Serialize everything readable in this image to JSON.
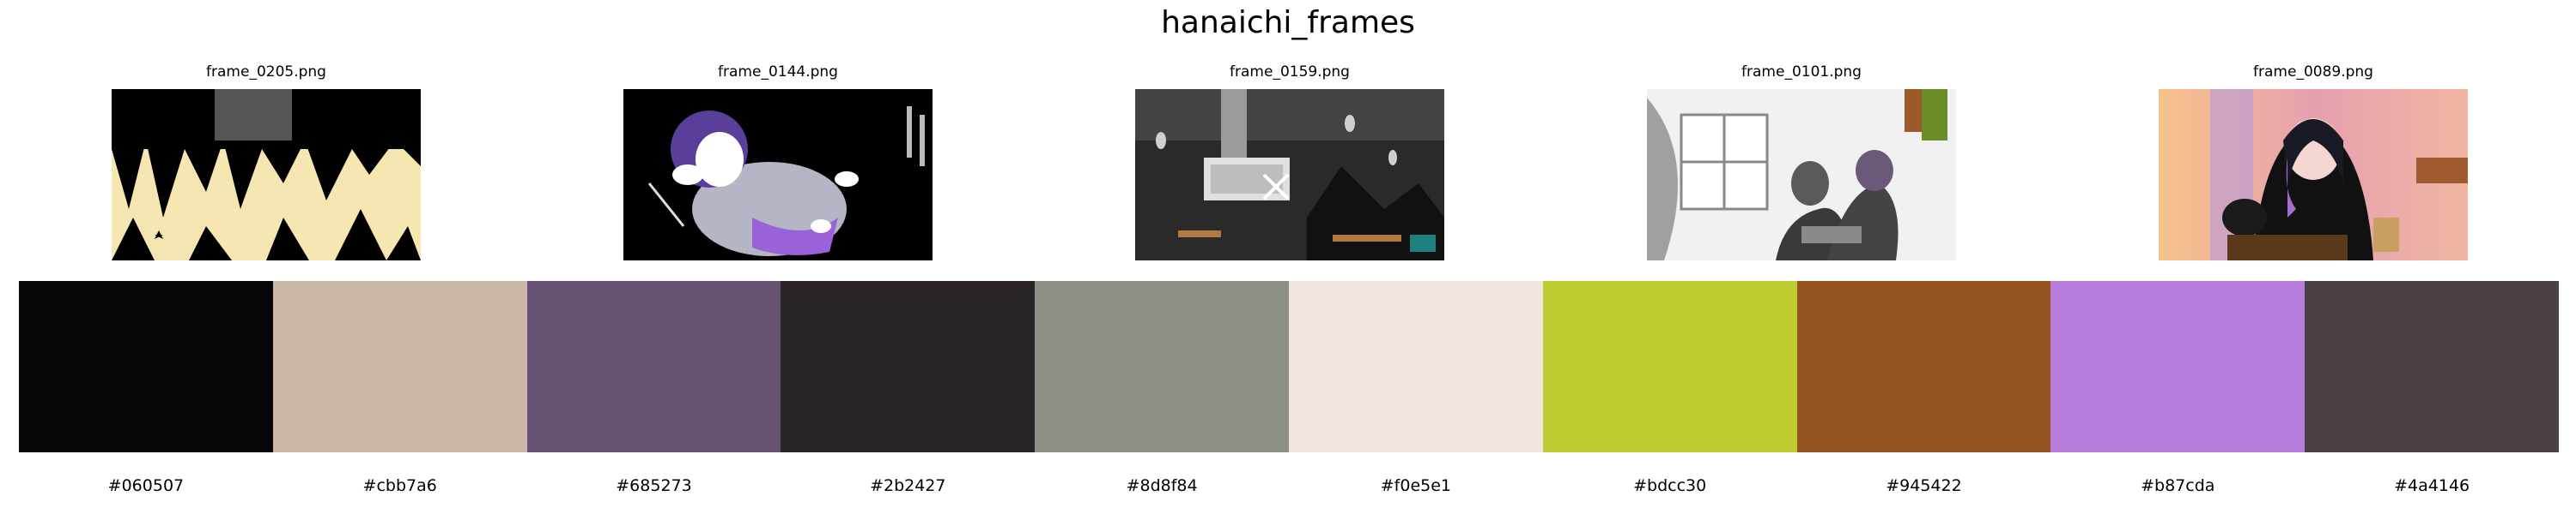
{
  "title": "hanaichi_frames",
  "frames": [
    {
      "filename": "frame_0205.png",
      "dominant": "#f6e7b2"
    },
    {
      "filename": "frame_0144.png",
      "dominant": "#000000"
    },
    {
      "filename": "frame_0159.png",
      "dominant": "#2a2a2a"
    },
    {
      "filename": "frame_0101.png",
      "dominant": "#dcdcdc"
    },
    {
      "filename": "frame_0089.png",
      "dominant": "#e9a98a"
    }
  ],
  "palette": [
    {
      "hex": "#060507"
    },
    {
      "hex": "#cbb7a6"
    },
    {
      "hex": "#685273"
    },
    {
      "hex": "#2b2427"
    },
    {
      "hex": "#8d8f84"
    },
    {
      "hex": "#f0e5e1"
    },
    {
      "hex": "#bdcc30"
    },
    {
      "hex": "#945422"
    },
    {
      "hex": "#b87cda"
    },
    {
      "hex": "#4a4146"
    }
  ]
}
